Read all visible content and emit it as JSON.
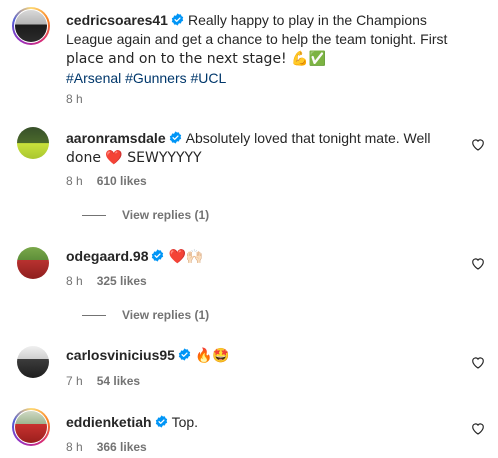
{
  "post": {
    "username": "cedricsoares41",
    "caption": "Really happy to play in the Champions League again and get a chance to help the team tonight. First place and on to the next stage! 💪✅",
    "caption_line1": "Really happy to play in the Champions",
    "caption_line2": "League again and get a chance to help the team tonight. First",
    "caption_line3": "place and on to the next stage! 💪✅",
    "hashtags": "#Arsenal #Gunners #UCL",
    "time": "8 h"
  },
  "comments": [
    {
      "username": "aaronramsdale",
      "text_line1": "Absolutely loved that tonight mate. Well",
      "text_line2": "done ❤️ SEWYYYYY",
      "time": "8 h",
      "likes": "610 likes",
      "view_replies": "View replies (1)"
    },
    {
      "username": "odegaard.98",
      "text": "❤️🙌🏻",
      "time": "8 h",
      "likes": "325 likes",
      "view_replies": "View replies (1)"
    },
    {
      "username": "carlosvinicius95",
      "text": "🔥🤩",
      "time": "7 h",
      "likes": "54 likes"
    },
    {
      "username": "eddienketiah",
      "text": "Top.",
      "time": "8 h",
      "likes": "366 likes"
    }
  ],
  "colors": {
    "verified": "#0095f6",
    "text": "#262626",
    "muted": "#737373",
    "hashtag": "#00376b",
    "heart_red": "#ed4956"
  },
  "icons": [
    "verified-badge-icon",
    "heart-outline-icon"
  ]
}
